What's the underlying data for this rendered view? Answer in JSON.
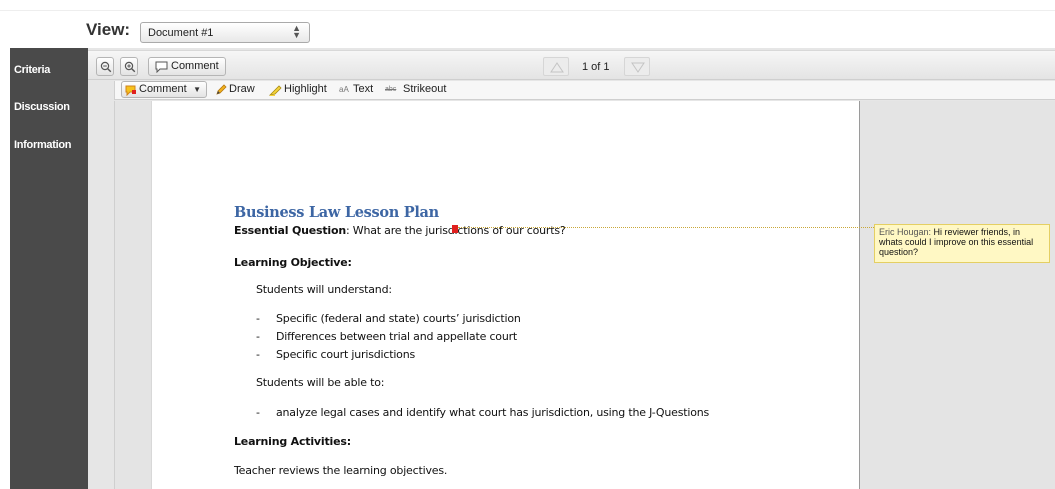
{
  "viewbar": {
    "label": "View:",
    "selected_document": "Document #1"
  },
  "sidebar": {
    "items": [
      {
        "label": "Criteria"
      },
      {
        "label": "Discussion"
      },
      {
        "label": "Information"
      }
    ]
  },
  "toolbar": {
    "comment_label": "Comment",
    "page_indicator": "1 of 1"
  },
  "annotation_tools": {
    "comment_label": "Comment",
    "draw_label": "Draw",
    "highlight_label": "Highlight",
    "text_label": "Text",
    "strikeout_label": "Strikeout",
    "text_icon_glyph": "aA",
    "strikeout_icon_glyph": "abc"
  },
  "document": {
    "title": "Business Law Lesson Plan",
    "essential_question_label": "Essential Question",
    "essential_question_text": ":  What are the jurisdictions of our courts?",
    "learning_objective_heading": "Learning Objective:",
    "understand_intro": "Students will understand:",
    "understand_items": [
      "Specific (federal and state) courts’ jurisdiction",
      "Differences between trial and appellate court",
      "Specific court jurisdictions"
    ],
    "able_intro": "Students will be able to:",
    "able_items": [
      "analyze legal cases and identify what court has jurisdiction, using the J-Questions"
    ],
    "learning_activities_heading": "Learning Activities:",
    "activity_1": "Teacher reviews the learning objectives."
  },
  "annotation": {
    "author": "Eric Hougan:",
    "text": " Hi reviewer friends, in whats could I improve on this essential question?",
    "marker_color": "#e0201e",
    "note_color": "#fff8c4"
  },
  "colors": {
    "sidebar_bg": "#4a4a4a",
    "title_blue": "#3d66a4"
  }
}
